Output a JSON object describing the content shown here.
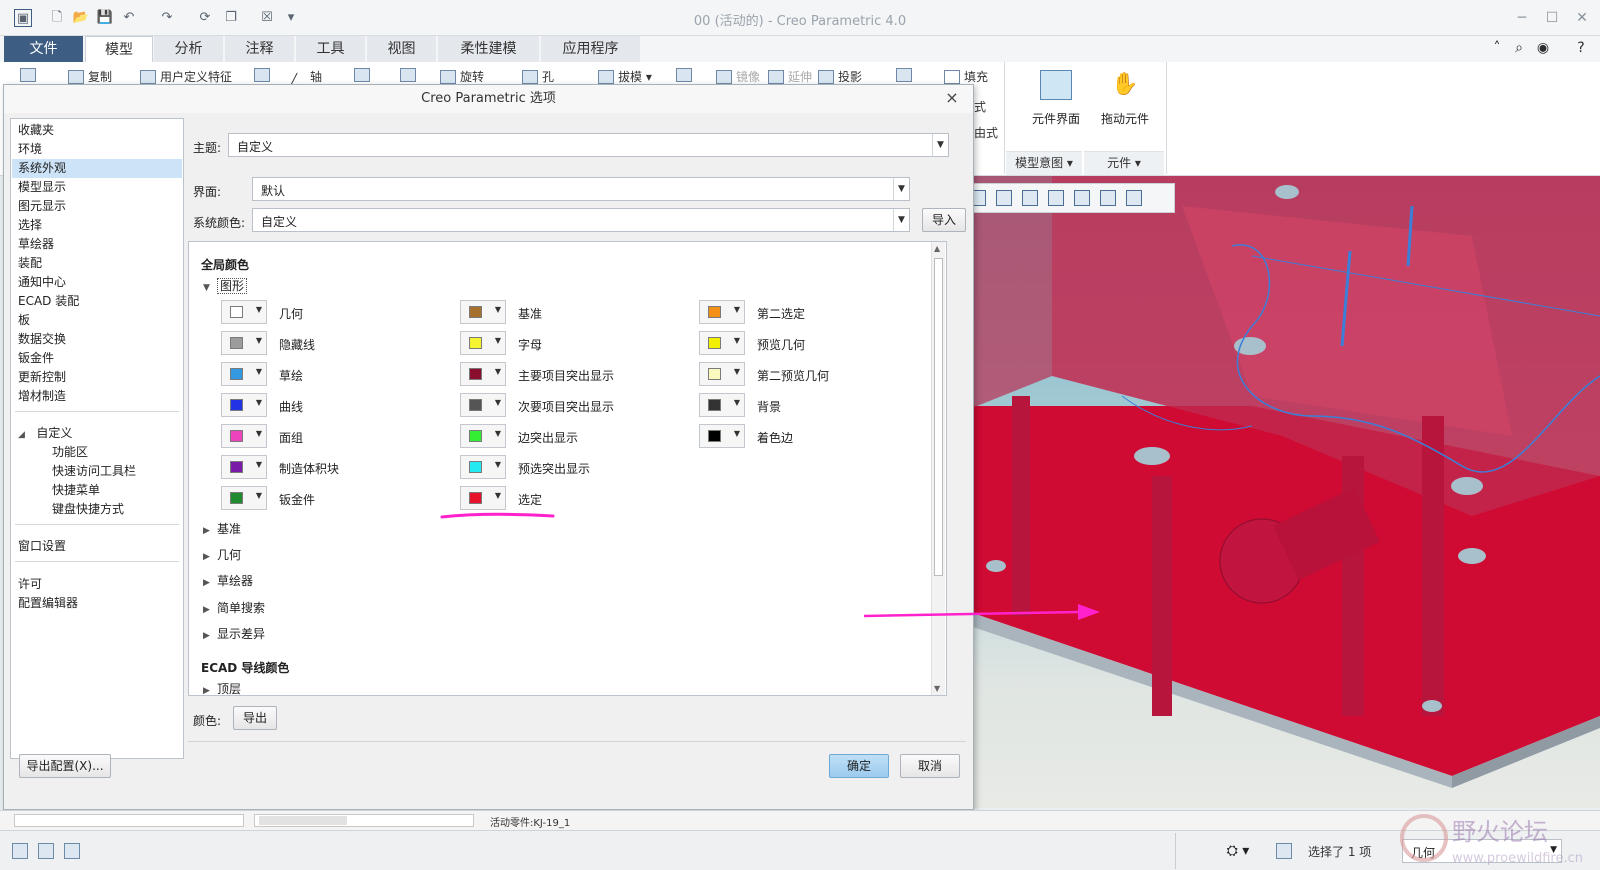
{
  "window": {
    "title": "00 (活动的) - Creo Parametric 4.0"
  },
  "tabs": [
    {
      "label": "文件"
    },
    {
      "label": "模型"
    },
    {
      "label": "分析"
    },
    {
      "label": "注释"
    },
    {
      "label": "工具"
    },
    {
      "label": "视图"
    },
    {
      "label": "柔性建模"
    },
    {
      "label": "应用程序"
    }
  ],
  "active_tab": "模型",
  "ribbon": {
    "items": [
      "复制",
      "用户定义特征",
      "轴",
      "旋转",
      "孔",
      "拔模",
      "镜像",
      "延伸",
      "投影",
      "填充"
    ],
    "right_labels": [
      "式",
      "由式"
    ],
    "buttons": [
      "元件界面",
      "拖动元件"
    ],
    "groups": [
      "模型意图",
      "元件"
    ]
  },
  "dialog": {
    "title": "Creo Parametric 选项",
    "nav": {
      "items": [
        "收藏夹",
        "环境",
        "系统外观",
        "模型显示",
        "图元显示",
        "选择",
        "草绘器",
        "装配",
        "通知中心",
        "ECAD 装配",
        "板",
        "数据交换",
        "钣金件",
        "更新控制",
        "增材制造"
      ],
      "selected": "系统外观",
      "custom_group": "自定义",
      "custom_children": [
        "功能区",
        "快速访问工具栏",
        "快捷菜单",
        "键盘快捷方式"
      ],
      "window_settings": "窗口设置",
      "license": "许可",
      "config_editor": "配置编辑器"
    },
    "theme": {
      "label": "主题:",
      "value": "自定义"
    },
    "interface": {
      "label": "界面:",
      "value": "默认"
    },
    "system_colors": {
      "label": "系统颜色:",
      "value": "自定义"
    },
    "import_button": "导入",
    "global_colors": {
      "title": "全局颜色",
      "graphics_group": "图形",
      "columns": [
        [
          {
            "name": "几何",
            "color": "#ffffff"
          },
          {
            "name": "隐藏线",
            "color": "#9c9c9c"
          },
          {
            "name": "草绘",
            "color": "#3399e0"
          },
          {
            "name": "曲线",
            "color": "#2233e6"
          },
          {
            "name": "面组",
            "color": "#ee44bb"
          },
          {
            "name": "制造体积块",
            "color": "#7a1aa8"
          },
          {
            "name": "钣金件",
            "color": "#1f8a2e"
          }
        ],
        [
          {
            "name": "基准",
            "color": "#a8702e"
          },
          {
            "name": "字母",
            "color": "#f4f430"
          },
          {
            "name": "主要项目突出显示",
            "color": "#8a0f2e"
          },
          {
            "name": "次要项目突出显示",
            "color": "#555555"
          },
          {
            "name": "边突出显示",
            "color": "#33ee33"
          },
          {
            "name": "预选突出显示",
            "color": "#22eaf0"
          },
          {
            "name": "选定",
            "color": "#e8112b"
          }
        ],
        [
          {
            "name": "第二选定",
            "color": "#f39018"
          },
          {
            "name": "预览几何",
            "color": "#f2f000"
          },
          {
            "name": "第二预览几何",
            "color": "#fafabf"
          },
          {
            "name": "背景",
            "color": "#333333"
          },
          {
            "name": "着色边",
            "color": "#000000"
          }
        ]
      ],
      "collapsed_groups": [
        "基准",
        "几何",
        "草绘器",
        "简单搜索",
        "显示差异"
      ]
    },
    "ecad": {
      "title": "ECAD 导线颜色",
      "groups": [
        "顶层"
      ]
    },
    "color_label": "颜色:",
    "export_button": "导出",
    "export_config_button": "导出配置(X)...",
    "ok_button": "确定",
    "cancel_button": "取消"
  },
  "status": {
    "active_part": "活动零件:KJ-19_1",
    "selection": "选择了 1 项",
    "filter": "几何"
  },
  "accent_colors": {
    "file_tab": "#3d5d83",
    "highlight": "#e8112b",
    "annotation": "#ff22cc"
  }
}
